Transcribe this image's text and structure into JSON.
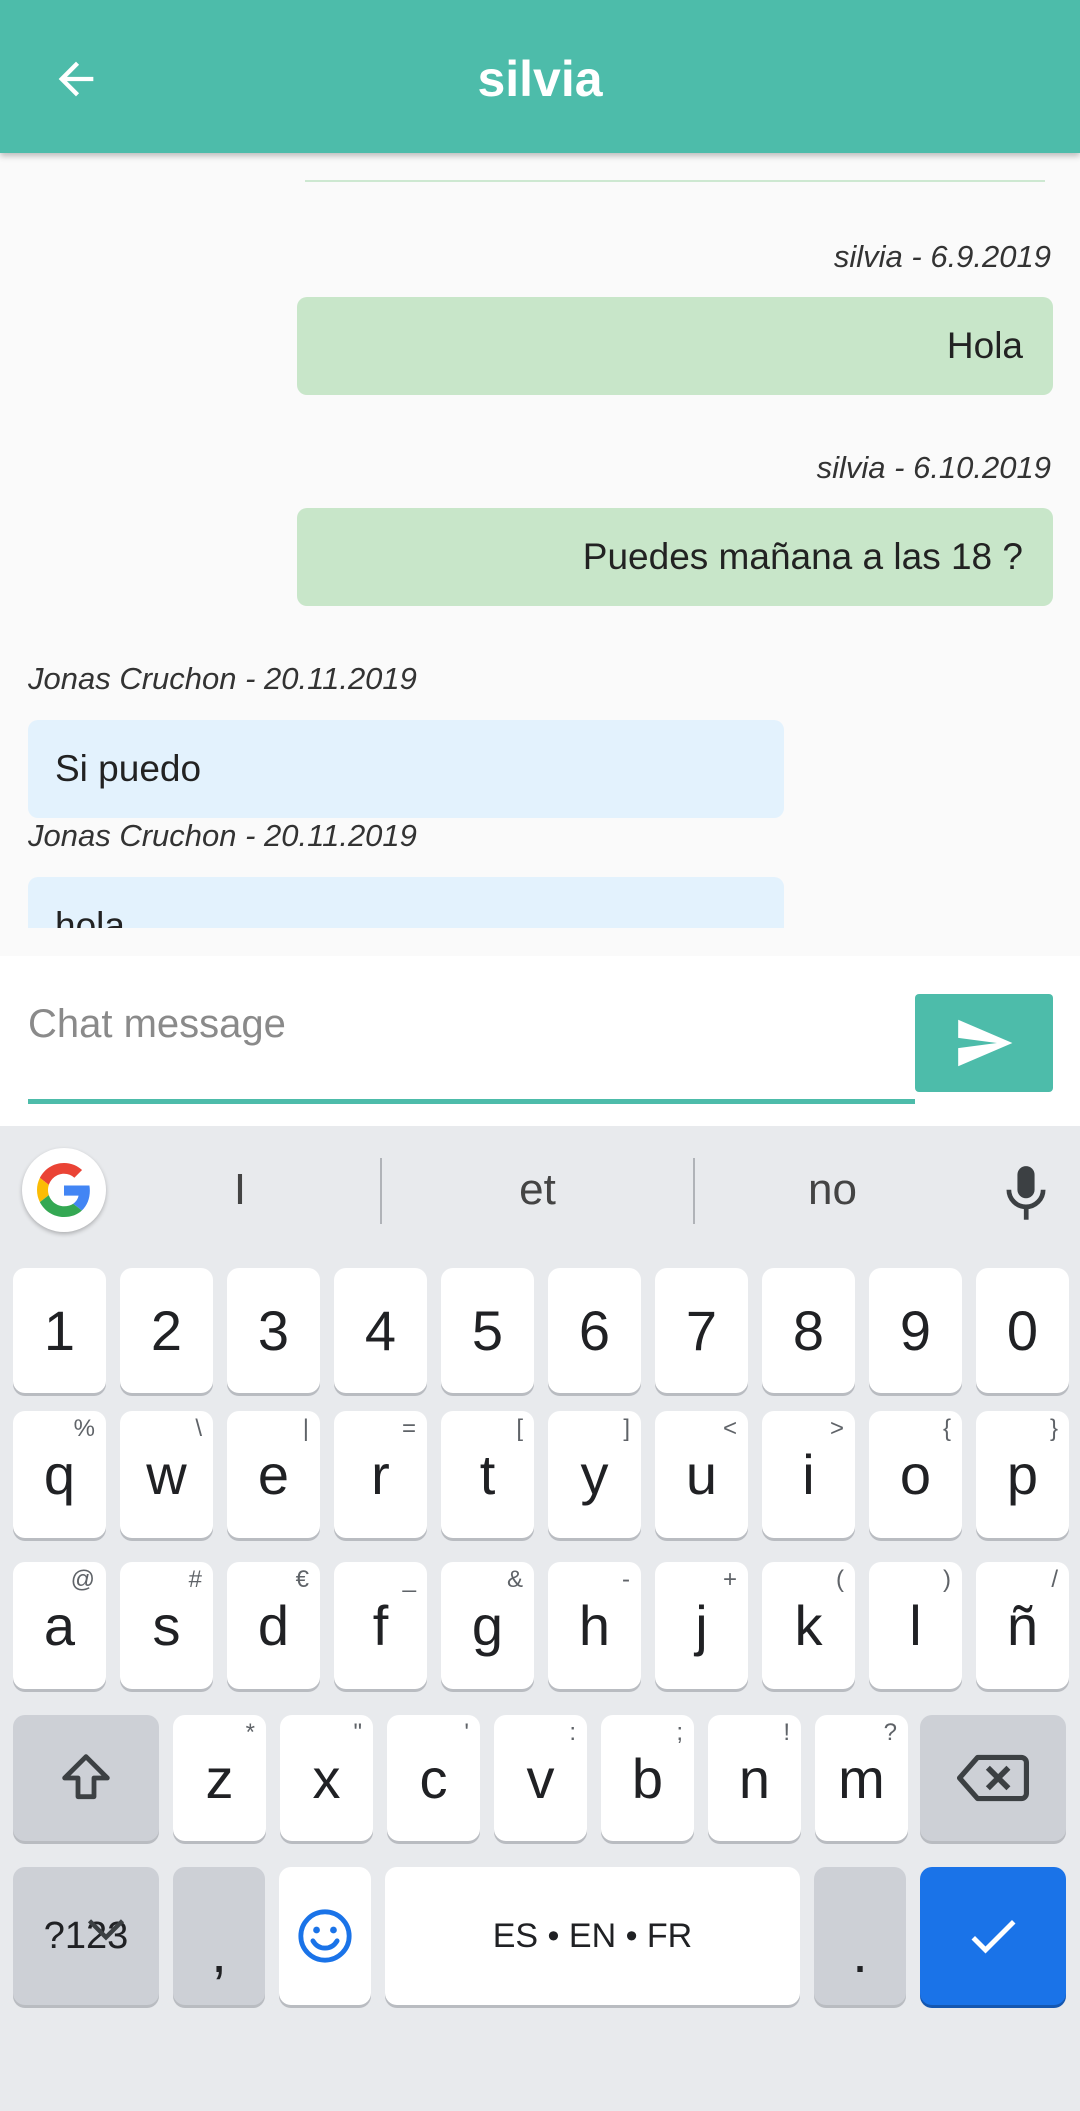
{
  "appbar": {
    "title": "silvia",
    "back_icon": "arrow-left-icon"
  },
  "messages": [
    {
      "side": "mine",
      "meta": "silvia - 6.9.2019",
      "text": "Hola"
    },
    {
      "side": "mine",
      "meta": "silvia - 6.10.2019",
      "text": "Puedes mañana a las 18 ?"
    },
    {
      "side": "theirs",
      "meta": "Jonas Cruchon - 20.11.2019",
      "text": "Si puedo"
    },
    {
      "side": "theirs",
      "meta": "Jonas Cruchon - 20.11.2019",
      "text": "hola"
    }
  ],
  "composer": {
    "placeholder": "Chat message",
    "value": "",
    "send_icon": "send-icon"
  },
  "keyboard": {
    "suggestions": [
      "I",
      "et",
      "no"
    ],
    "numbers": [
      "1",
      "2",
      "3",
      "4",
      "5",
      "6",
      "7",
      "8",
      "9",
      "0"
    ],
    "row1": [
      {
        "k": "q",
        "h": "%"
      },
      {
        "k": "w",
        "h": "\\"
      },
      {
        "k": "e",
        "h": "|"
      },
      {
        "k": "r",
        "h": "="
      },
      {
        "k": "t",
        "h": "["
      },
      {
        "k": "y",
        "h": "]"
      },
      {
        "k": "u",
        "h": "<"
      },
      {
        "k": "i",
        "h": ">"
      },
      {
        "k": "o",
        "h": "{"
      },
      {
        "k": "p",
        "h": "}"
      }
    ],
    "row2": [
      {
        "k": "a",
        "h": "@"
      },
      {
        "k": "s",
        "h": "#"
      },
      {
        "k": "d",
        "h": "€"
      },
      {
        "k": "f",
        "h": "_"
      },
      {
        "k": "g",
        "h": "&"
      },
      {
        "k": "h",
        "h": "-"
      },
      {
        "k": "j",
        "h": "+"
      },
      {
        "k": "k",
        "h": "("
      },
      {
        "k": "l",
        "h": ")"
      },
      {
        "k": "ñ",
        "h": "/"
      }
    ],
    "row3": [
      {
        "k": "z",
        "h": "*"
      },
      {
        "k": "x",
        "h": "\""
      },
      {
        "k": "c",
        "h": "'"
      },
      {
        "k": "v",
        "h": ":"
      },
      {
        "k": "b",
        "h": ";"
      },
      {
        "k": "n",
        "h": "!"
      },
      {
        "k": "m",
        "h": "?"
      }
    ],
    "symbols_label": "?123",
    "comma": ",",
    "space_label": "ES • EN • FR",
    "period": "."
  },
  "colors": {
    "accent": "#4dbcaa",
    "mine_bubble": "#c8e6c9",
    "theirs_bubble": "#e3f2fd",
    "done_key": "#1a73e8"
  }
}
